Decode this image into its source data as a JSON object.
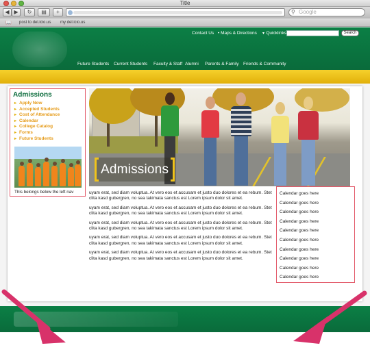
{
  "window": {
    "title": "Title"
  },
  "browser": {
    "search_placeholder": "Google",
    "bookmarks": [
      "post to del.icio.us",
      "my del.icio.us"
    ]
  },
  "site": {
    "utility_links": [
      "Contact Us",
      "Maps & Directions",
      "Quicklinks"
    ],
    "search_button": "Search",
    "nav": [
      "Future Students",
      "Current Students",
      "Faculty & Staff",
      "Alumni",
      "Parents & Family",
      "Friends & Community"
    ]
  },
  "leftnav": {
    "heading": "Admissions",
    "items": [
      "Apply Now",
      "Accepted Students",
      "Cost of Attendance",
      "Calendar",
      "College Catalog",
      "Forms",
      "Future Students"
    ],
    "caption": "This belongs below the left nav"
  },
  "hero": {
    "title": "Admissions"
  },
  "body": {
    "paragraphs": [
      "uyam erat, sed diam voluptua. At vero eos et accusam et justo duo dolores et ea rebum. Stet clita kasd gubergren, no sea takimata sanctus est Lorem ipsum dolor sit amet.",
      "uyam erat, sed diam voluptua. At vero eos et accusam et justo duo dolores et ea rebum. Stet clita kasd gubergren, no sea takimata sanctus est Lorem ipsum dolor sit amet.",
      "uyam erat, sed diam voluptua. At vero eos et accusam et justo duo dolores et ea rebum. Stet clita kasd gubergren, no sea takimata sanctus est Lorem ipsum dolor sit amet.",
      "uyam erat, sed diam voluptua. At vero eos et accusam et justo duo dolores et ea rebum. Stet clita kasd gubergren, no sea takimata sanctus est Lorem ipsum dolor sit amet.",
      "uyam erat, sed diam voluptua. At vero eos et accusam et justo duo dolores et ea rebum. Stet clita kasd gubergren, no sea takimata sanctus est Lorem ipsum dolor sit amet."
    ]
  },
  "calendar": {
    "items": [
      "Calendar goes here",
      "Calendar goes here",
      "Calendar goes here",
      "Calendar goes here",
      "Calendar goes here",
      "Calendar goes here",
      "Calendar goes here",
      "Calendar goes here",
      "Calendar goes here",
      "Calendar goes here"
    ]
  },
  "colors": {
    "brand_green": "#0a6b3b",
    "gold": "#f0c31c",
    "link_orange": "#e59a17",
    "annotation_arrow": "#d8326a"
  },
  "icons": [
    "back-icon",
    "forward-icon",
    "reload-icon",
    "add-bookmark-icon",
    "search-icon",
    "bookmarks-icon",
    "arrow-annotation"
  ]
}
